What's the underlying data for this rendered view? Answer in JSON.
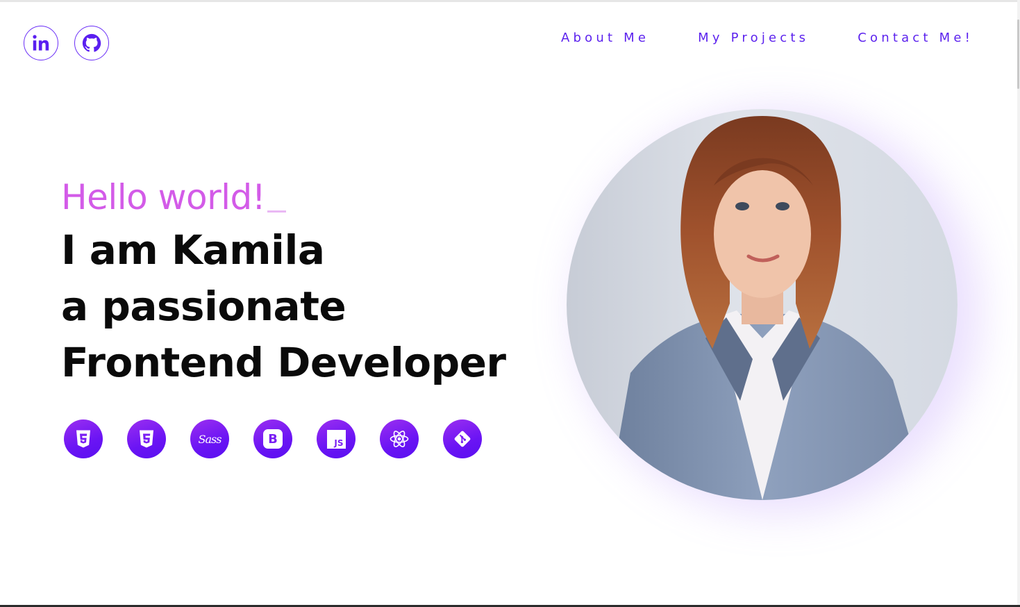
{
  "social": {
    "linkedin_icon": "linkedin-icon",
    "github_icon": "github-icon"
  },
  "nav": {
    "items": [
      {
        "label": "About Me"
      },
      {
        "label": "My Projects"
      },
      {
        "label": "Contact Me!"
      }
    ]
  },
  "hero": {
    "greeting": "Hello world!",
    "line1": "I am Kamila",
    "line2": "a passionate",
    "line3": "Frontend Developer"
  },
  "tech_stack": [
    {
      "icon": "html5-icon"
    },
    {
      "icon": "css3-icon"
    },
    {
      "icon": "sass-icon",
      "text": "Sass"
    },
    {
      "icon": "bootstrap-icon",
      "text": "B"
    },
    {
      "icon": "javascript-icon",
      "text": "JS"
    },
    {
      "icon": "react-icon"
    },
    {
      "icon": "git-icon"
    }
  ],
  "colors": {
    "accent": "#5c22ee",
    "greeting": "#d35be8",
    "icon_gradient_start": "#9b2ff0",
    "icon_gradient_end": "#5a10f0",
    "heading": "#0a0a0a"
  }
}
